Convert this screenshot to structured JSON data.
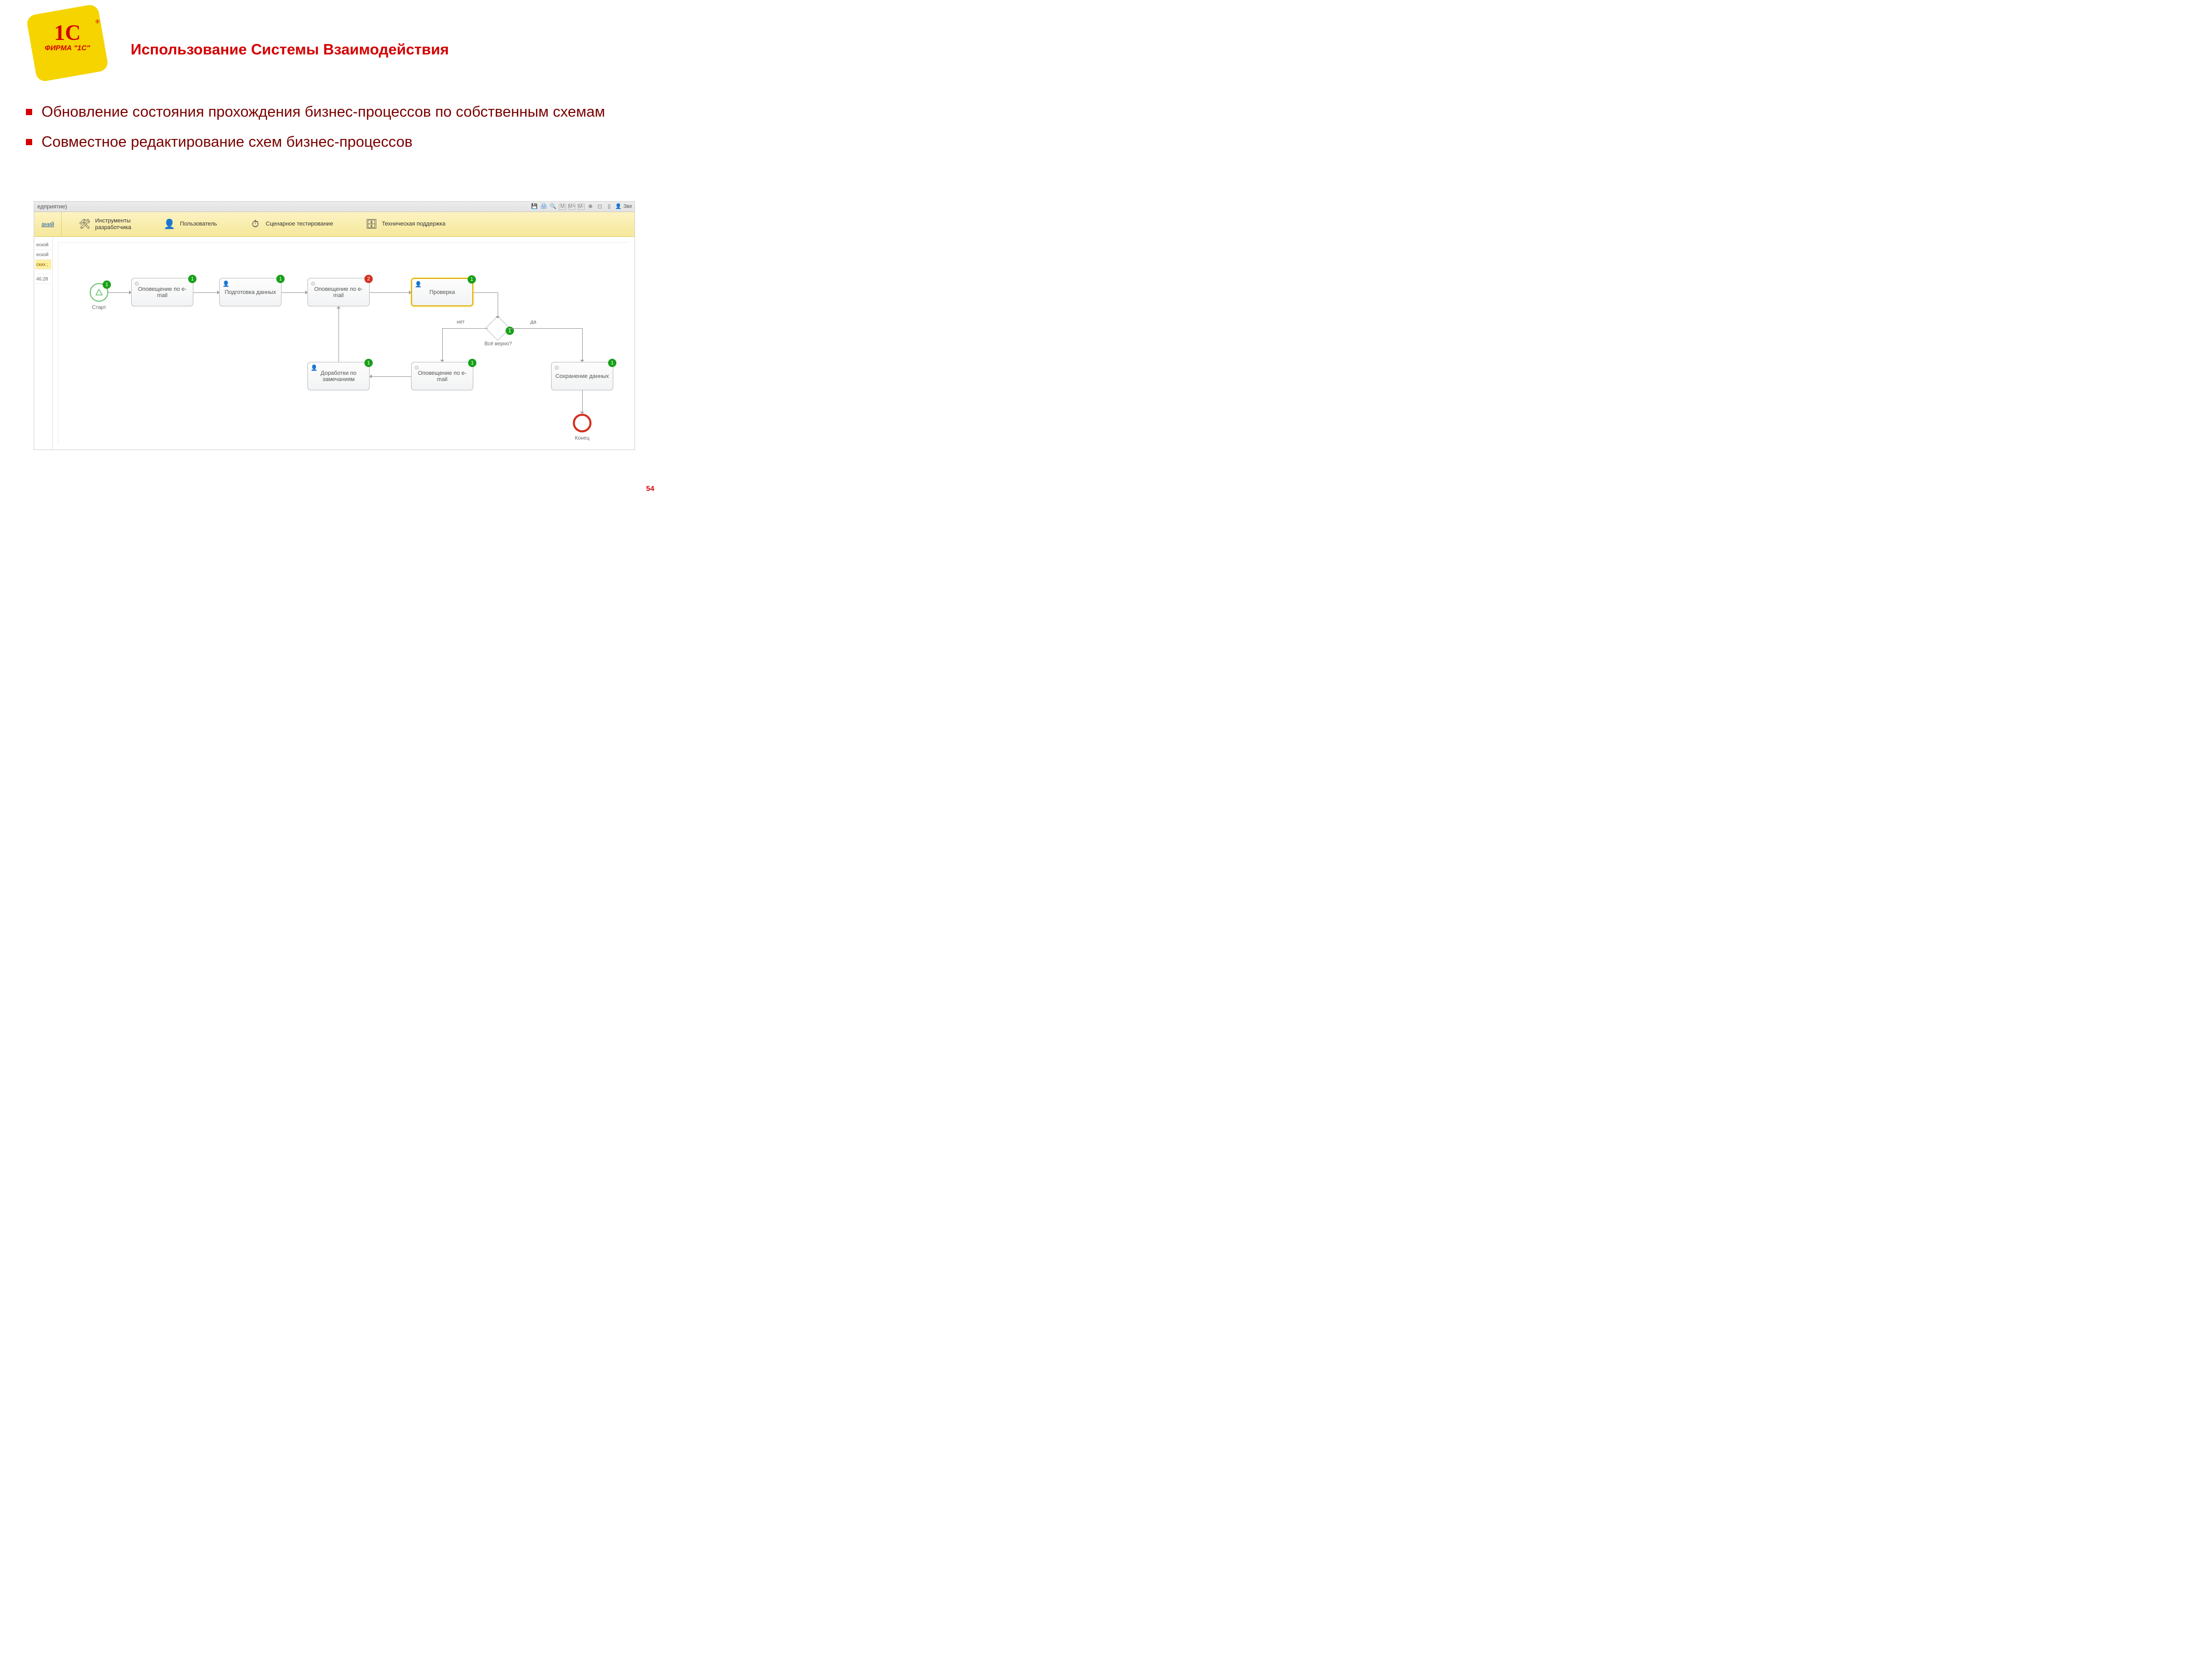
{
  "logo": {
    "main": "1С",
    "reg": "®",
    "sub": "ФИРМА \"1С\""
  },
  "slide_title": "Использование Системы Взаимодействия",
  "bullets": [
    "Обновление состояния прохождения бизнес-процессов по собственным схемам",
    "Совместное редактирование схем бизнес-процессов"
  ],
  "shot": {
    "title_left": "едприятие)",
    "toolbar_right": [
      "💾",
      "🖨",
      "🔍",
      "M",
      "M+",
      "M-",
      "⊕",
      "◻",
      "▯",
      "👤",
      "Зве"
    ],
    "ribbon_link": "аний",
    "ribbon": [
      {
        "label": "Инструменты\nразработчика",
        "glyph": "🛠"
      },
      {
        "label": "Пользователь",
        "glyph": "👤"
      },
      {
        "label": "Сценарное тестирование",
        "glyph": "⏱"
      },
      {
        "label": "Техническая поддержка",
        "glyph": "🗄"
      }
    ],
    "side": [
      "еской",
      "еской",
      "ских ;",
      "",
      "46:28"
    ]
  },
  "bpmn": {
    "start": {
      "label": "Старт"
    },
    "end": {
      "label": "Конец"
    },
    "gate": {
      "label": "Всё верно?",
      "edge_no": "нет",
      "edge_yes": "да"
    },
    "nodes": {
      "n1": {
        "text": "Оповещение по e-mail",
        "badge": "1",
        "corner": "⚙"
      },
      "n2": {
        "text": "Подготовка данных",
        "badge": "1",
        "corner": "👤"
      },
      "n3": {
        "text": "Оповещение по e-mail",
        "badge": "2",
        "corner": "⚙",
        "badgeRed": true
      },
      "n4": {
        "text": "Проверка",
        "badge": "1",
        "corner": "👤",
        "selected": true
      },
      "n5": {
        "text": "Доработки по замечаниям",
        "badge": "1",
        "corner": "👤"
      },
      "n6": {
        "text": "Оповещение по e-mail",
        "badge": "1",
        "corner": "⚙"
      },
      "n7": {
        "text": "Сохранение данных",
        "badge": "1",
        "corner": "⚙"
      }
    }
  },
  "page_no": "54"
}
